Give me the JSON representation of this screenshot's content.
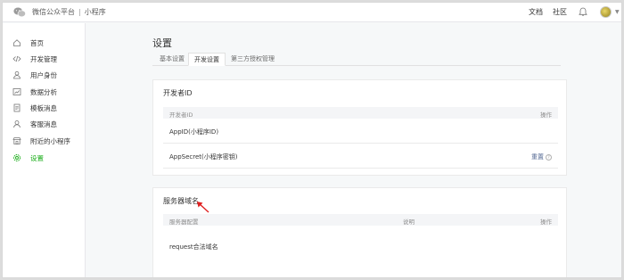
{
  "topbar": {
    "brand_name": "微信公众平台",
    "separator": "|",
    "product_name": "小程序",
    "nav_docs": "文档",
    "nav_community": "社区",
    "icons": [
      "wechat-logo-icon",
      "bell-icon",
      "avatar",
      "chevron-down-icon"
    ]
  },
  "sidebar": {
    "items": [
      {
        "label": "首页",
        "icon": "home-icon"
      },
      {
        "label": "开发管理",
        "icon": "code-icon"
      },
      {
        "label": "用户身份",
        "icon": "user-icon"
      },
      {
        "label": "数据分析",
        "icon": "chart-icon"
      },
      {
        "label": "模板消息",
        "icon": "document-icon"
      },
      {
        "label": "客服消息",
        "icon": "service-icon"
      },
      {
        "label": "附近的小程序",
        "icon": "store-icon"
      },
      {
        "label": "设置",
        "icon": "gear-icon",
        "active": true
      }
    ],
    "active_color": "#1aad19"
  },
  "main": {
    "title": "设置",
    "tabs": [
      {
        "label": "基本设置"
      },
      {
        "label": "开发设置",
        "active": true
      },
      {
        "label": "第三方授权管理"
      }
    ],
    "developer_card": {
      "title": "开发者ID",
      "header_left": "开发者ID",
      "header_right": "操作",
      "rows": [
        {
          "label": "AppID(小程序ID)"
        },
        {
          "label": "AppSecret(小程序密钥)",
          "action": "重置"
        }
      ]
    },
    "server_card": {
      "title": "服务器域名",
      "header_config": "服务器配置",
      "header_desc": "说明",
      "header_action": "操作",
      "rows": [
        {
          "label": "request合法域名"
        }
      ]
    }
  },
  "annotation": {
    "arrow_color": "#e02020"
  }
}
